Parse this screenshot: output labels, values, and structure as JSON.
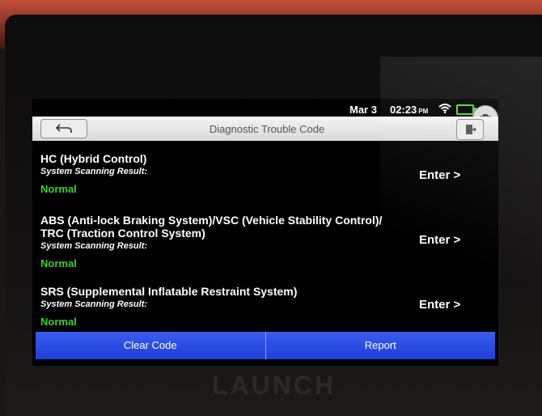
{
  "device": {
    "brand": "LAUNCH"
  },
  "status_bar": {
    "date": "Mar 3",
    "time": "02:23",
    "ampm": "PM"
  },
  "header": {
    "title": "Diagnostic Trouble Code"
  },
  "systems": [
    {
      "name_lines": [
        "HC (Hybrid Control)"
      ],
      "scan_label": "System Scanning Result:",
      "result": "Normal",
      "action": "Enter >"
    },
    {
      "name_lines": [
        "ABS (Anti-lock Braking System)/VSC (Vehicle Stability Control)/",
        "TRC (Traction Control System)"
      ],
      "scan_label": "System Scanning Result:",
      "result": "Normal",
      "action": "Enter >"
    },
    {
      "name_lines": [
        "SRS (Supplemental Inflatable Restraint System)"
      ],
      "scan_label": "System Scanning Result:",
      "result": "Normal",
      "action": "Enter >"
    }
  ],
  "footer": {
    "clear_code": "Clear Code",
    "report": "Report"
  },
  "colors": {
    "accent": "#2a4be6",
    "normal": "#3ad02a",
    "battery": "#5fd23b"
  },
  "icons": {
    "back": "back-arrow-icon",
    "exit": "exit-door-icon",
    "camera": "camera-icon",
    "wifi": "wifi-icon",
    "battery": "battery-icon"
  }
}
